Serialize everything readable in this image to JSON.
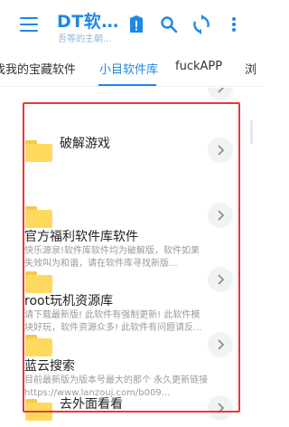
{
  "app": {
    "title": "DT软…",
    "subtitle": "吾等的主朝..."
  },
  "toolbar": {
    "icons": [
      "menu-icon",
      "notice-icon",
      "search-icon",
      "refresh-icon",
      "more-icon"
    ]
  },
  "tabs": [
    {
      "label": "找我的宝藏软件",
      "active": false
    },
    {
      "label": "小目软件库",
      "active": true
    },
    {
      "label": "fuckAPP",
      "active": false
    },
    {
      "label": "浏",
      "active": false
    }
  ],
  "items": [
    {
      "title": "破解游戏",
      "desc": [
        "",
        ""
      ]
    },
    {
      "title": "官方福利软件库软件",
      "desc": [
        "快乐源泉!软件库软件均为破解版，软件如果",
        "失效叫为和谐，请在软件库寻找新版..."
      ]
    },
    {
      "title": "root玩机资源库",
      "desc": [
        "请下载最新版! 此软件有强制更新! 此软件模",
        "块好玩，软件资源众多! 此软件有问题请反..."
      ]
    },
    {
      "title": "蓝云搜索",
      "desc": [
        "目前最新版为版本号最大的那个 永久更新链接",
        "https://www.lanzouj.com/b009..."
      ]
    },
    {
      "title": "去外面看看",
      "desc": [
        "",
        ""
      ]
    }
  ],
  "colors": {
    "accent": "#1e88e5",
    "highlight": "#e53935",
    "folder": "#ffd95e"
  }
}
